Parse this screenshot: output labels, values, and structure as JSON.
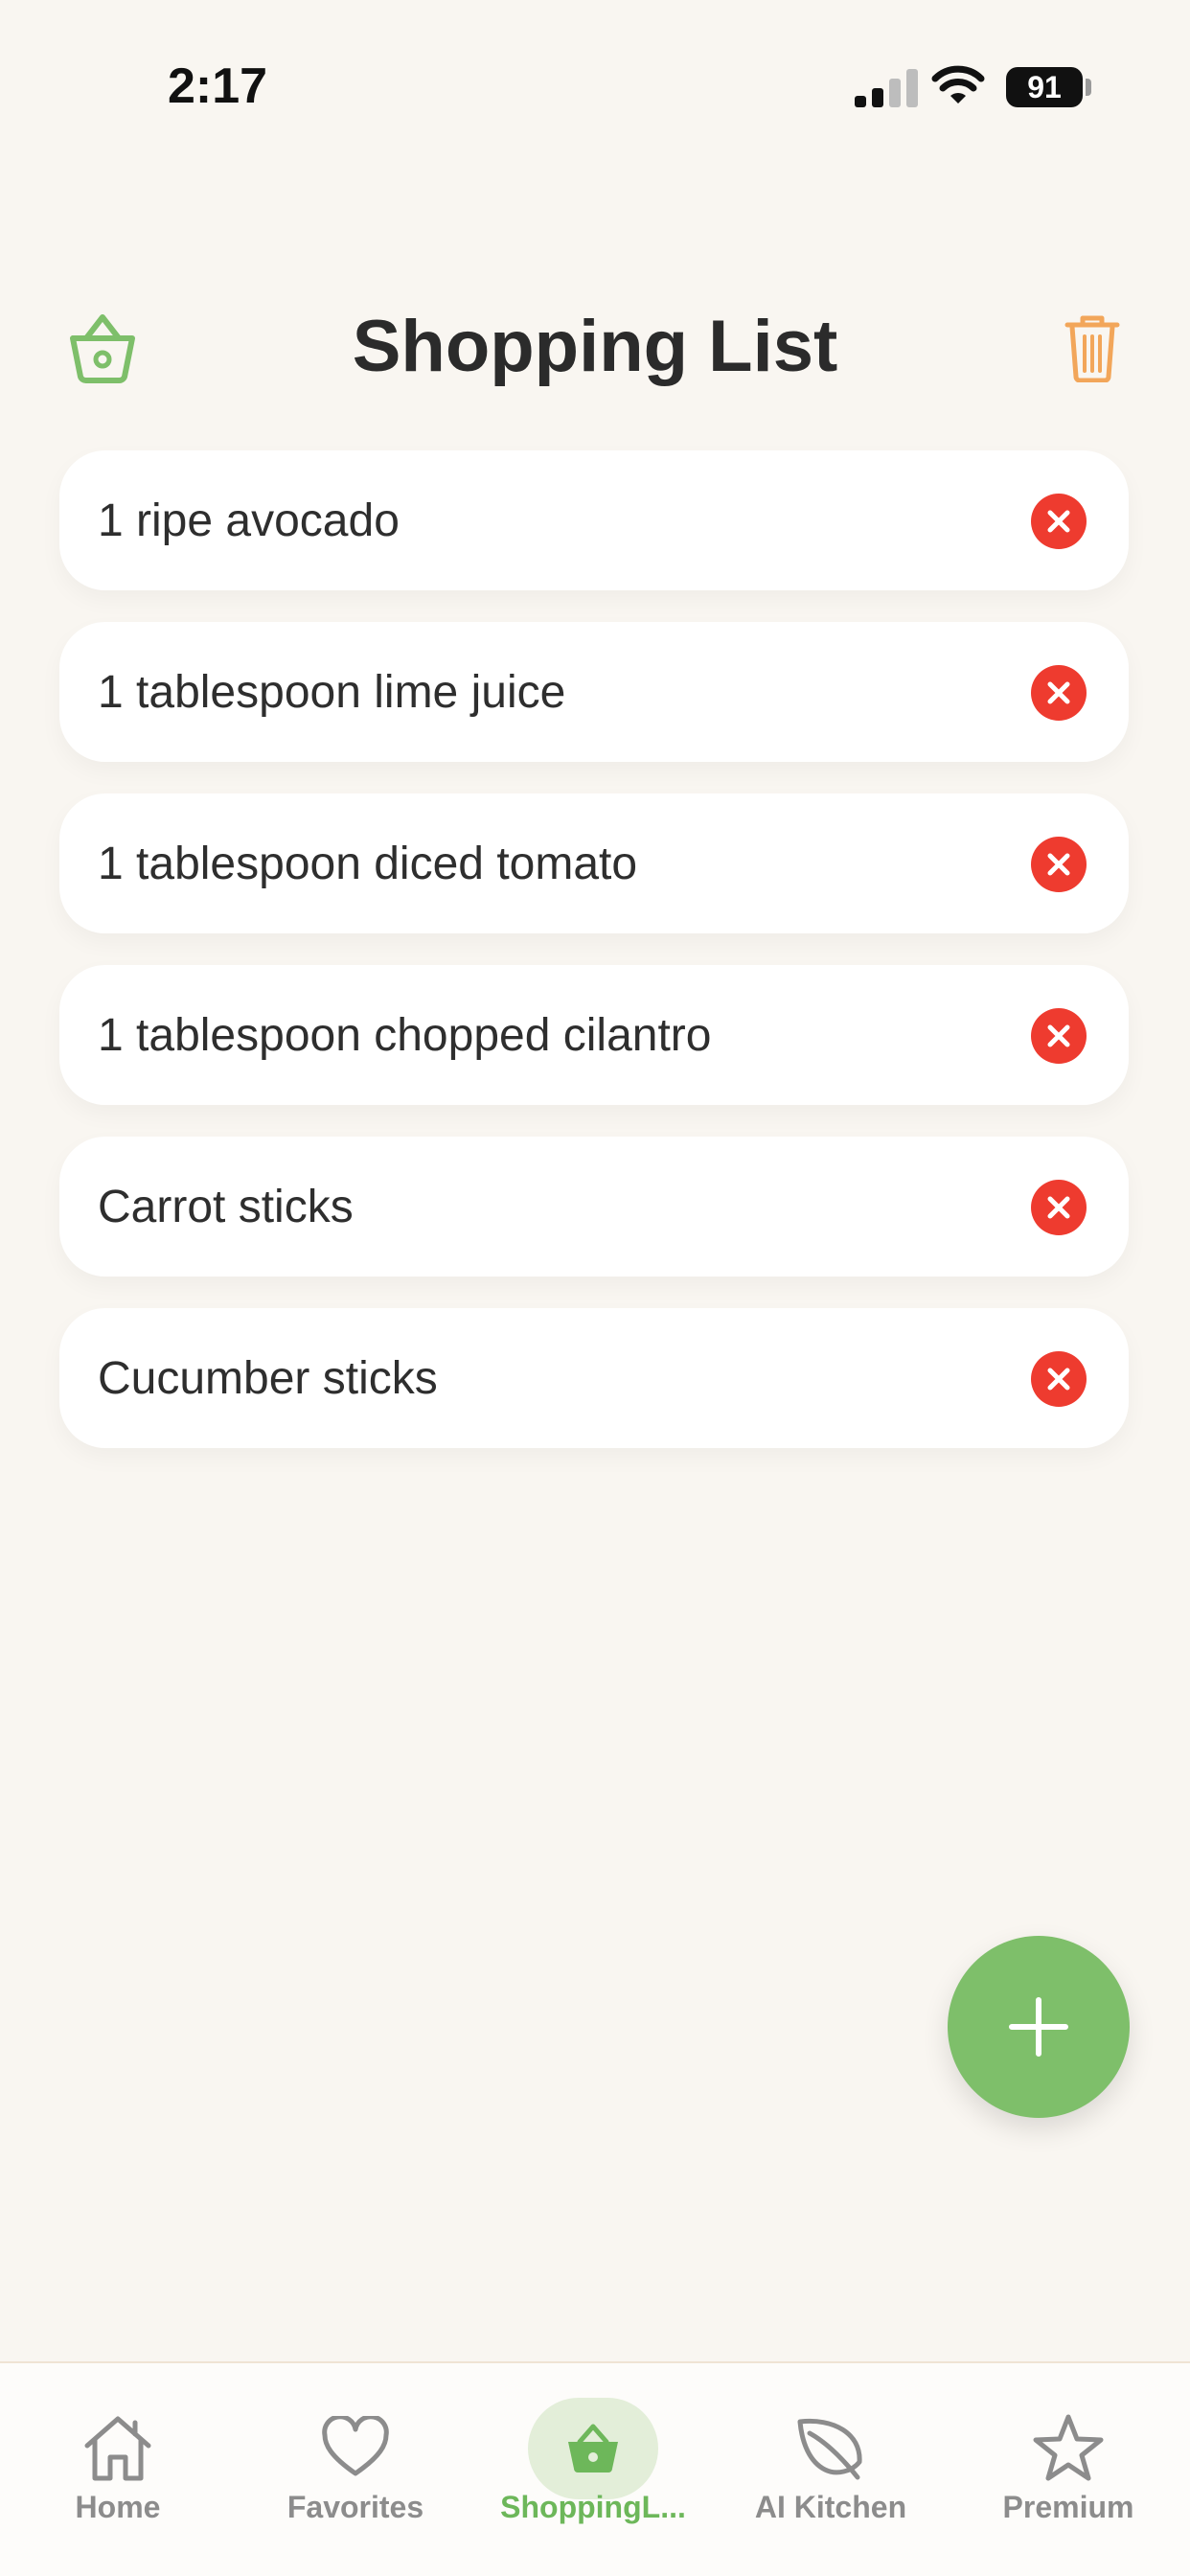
{
  "status_bar": {
    "time": "2:17",
    "battery": "91"
  },
  "header": {
    "title": "Shopping List",
    "left_icon": "basket-icon",
    "right_icon": "trash-icon"
  },
  "items": [
    {
      "text": "1 ripe avocado"
    },
    {
      "text": "1 tablespoon lime juice"
    },
    {
      "text": "1 tablespoon diced tomato"
    },
    {
      "text": "1 tablespoon chopped cilantro"
    },
    {
      "text": "Carrot sticks"
    },
    {
      "text": "Cucumber sticks"
    }
  ],
  "fab": {
    "icon": "plus-icon"
  },
  "tabs": [
    {
      "label": "Home",
      "icon": "home-icon"
    },
    {
      "label": "Favorites",
      "icon": "heart-icon"
    },
    {
      "label": "ShoppingL...",
      "icon": "basket-icon",
      "active": true
    },
    {
      "label": "AI Kitchen",
      "icon": "leaf-icon"
    },
    {
      "label": "Premium",
      "icon": "star-icon"
    }
  ],
  "colors": {
    "accent_green": "#7ebf6a",
    "delete_red": "#ee3b2f",
    "trash_orange": "#f2a65a",
    "background": "#f9f6f1"
  }
}
